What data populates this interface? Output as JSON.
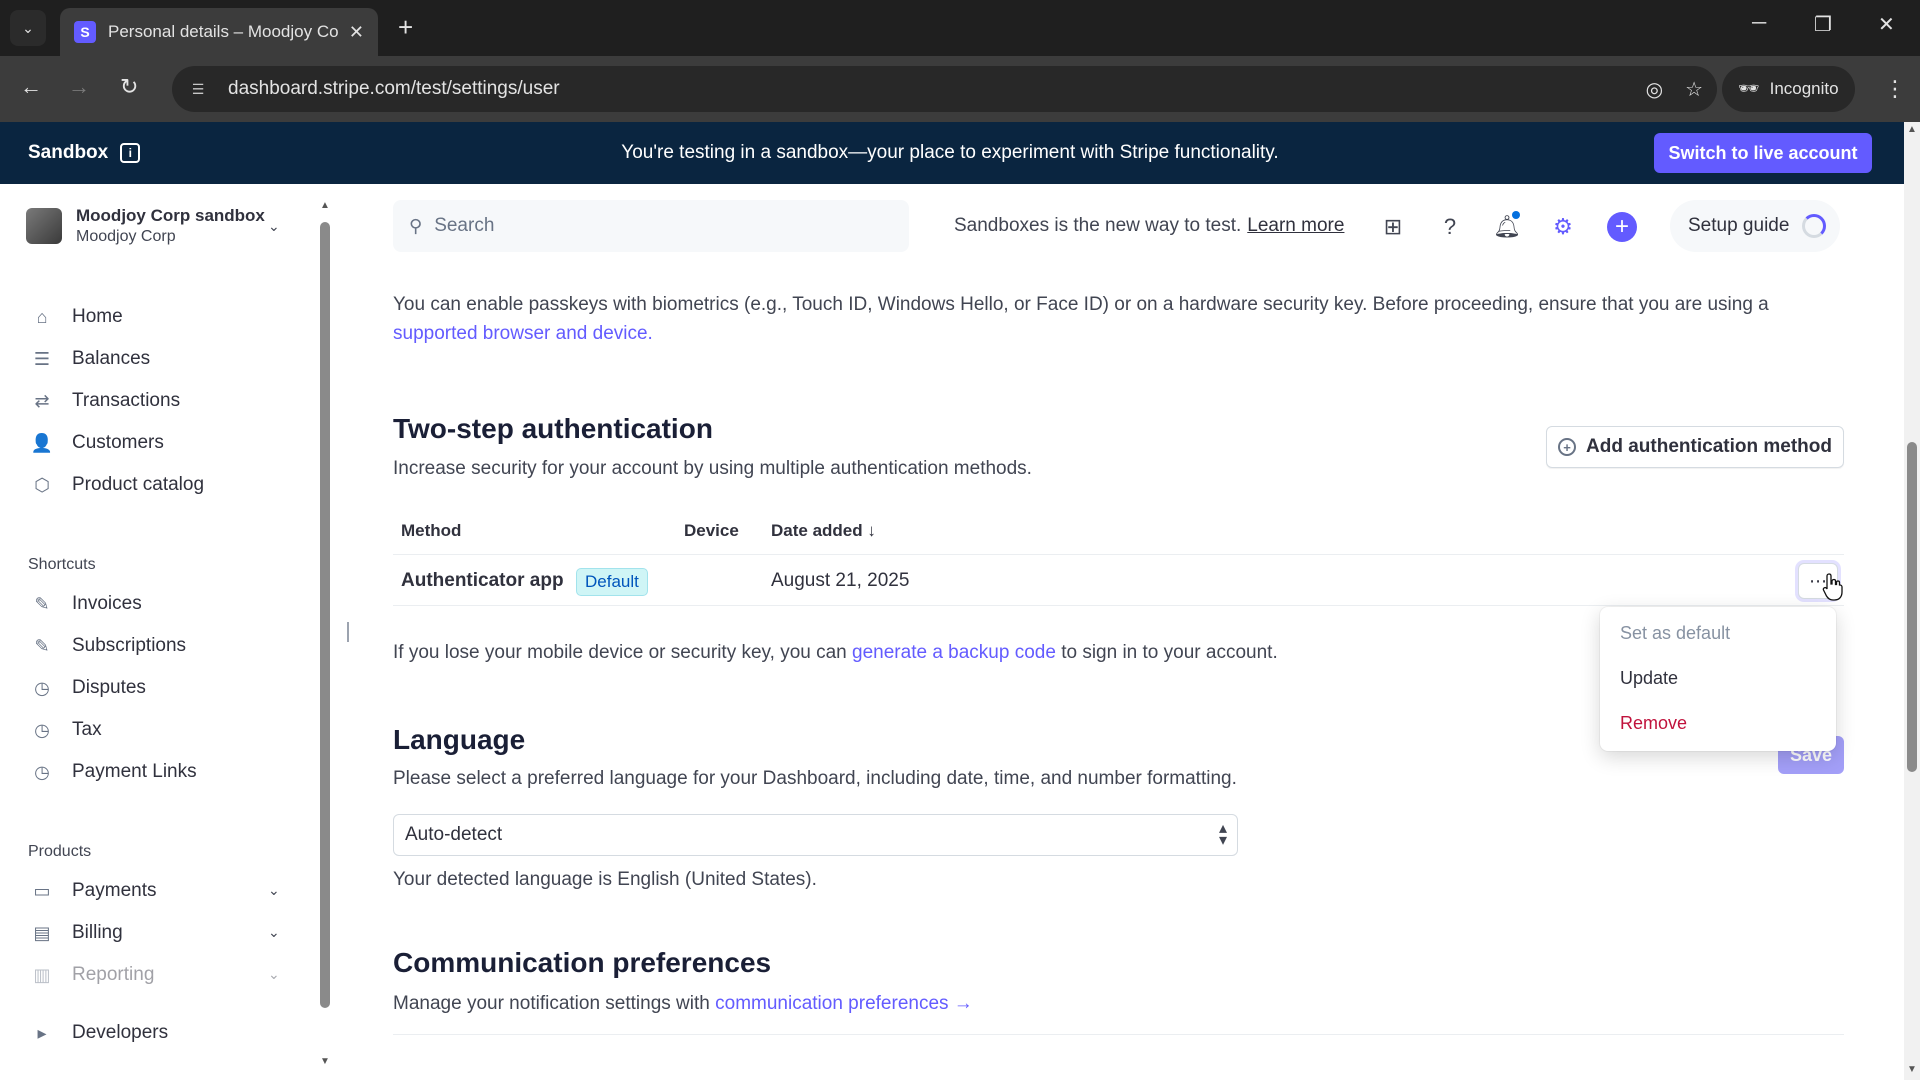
{
  "browser": {
    "tab_title": "Personal details – Moodjoy Corp",
    "favicon_letter": "S",
    "url": "dashboard.stripe.com/test/settings/user",
    "incognito_label": "Incognito"
  },
  "banner": {
    "label": "Sandbox",
    "message": "You're testing in a sandbox—your place to experiment with Stripe functionality.",
    "live_button": "Switch to live account"
  },
  "account": {
    "name": "Moodjoy Corp sandbox",
    "sub": "Moodjoy Corp"
  },
  "sidebar": {
    "items": [
      {
        "label": "Home",
        "icon": "home-icon"
      },
      {
        "label": "Balances",
        "icon": "balances-icon"
      },
      {
        "label": "Transactions",
        "icon": "transactions-icon"
      },
      {
        "label": "Customers",
        "icon": "customers-icon"
      },
      {
        "label": "Product catalog",
        "icon": "product-catalog-icon"
      }
    ],
    "shortcuts_heading": "Shortcuts",
    "shortcuts": [
      {
        "label": "Invoices",
        "icon": "pin-icon"
      },
      {
        "label": "Subscriptions",
        "icon": "pin-icon"
      },
      {
        "label": "Disputes",
        "icon": "clock-icon"
      },
      {
        "label": "Tax",
        "icon": "clock-icon"
      },
      {
        "label": "Payment Links",
        "icon": "clock-icon"
      }
    ],
    "products_heading": "Products",
    "products": [
      {
        "label": "Payments",
        "icon": "payments-icon"
      },
      {
        "label": "Billing",
        "icon": "billing-icon"
      },
      {
        "label": "Reporting",
        "icon": "reporting-icon"
      }
    ],
    "developers": "Developers"
  },
  "toolbar": {
    "search_placeholder": "Search",
    "sandbox_note": "Sandboxes is the new way to test.",
    "learn_more": "Learn more",
    "setup_guide": "Setup guide"
  },
  "passkeys": {
    "text": "You can enable passkeys with biometrics (e.g., Touch ID, Windows Hello, or Face ID) or on a hardware security key. Before proceeding, ensure that you are using a",
    "link": "supported browser and device."
  },
  "two_step": {
    "title": "Two-step authentication",
    "subtitle": "Increase security for your account by using multiple authentication methods.",
    "add_button": "Add authentication method",
    "columns": [
      "Method",
      "Device",
      "Date added ↓"
    ],
    "row": {
      "method": "Authenticator app",
      "badge": "Default",
      "device": "",
      "date": "August 21, 2025"
    },
    "backup_prefix": "If you lose your mobile device or security key, you can",
    "backup_link": "generate a backup code",
    "backup_suffix": "to sign in to your account."
  },
  "menu": {
    "items": [
      "Set as default",
      "Update",
      "Remove"
    ]
  },
  "language": {
    "title": "Language",
    "subtitle": "Please select a preferred language for your Dashboard, including date, time, and number formatting.",
    "value": "Auto-detect",
    "detected": "Your detected language is English (United States).",
    "save": "Save"
  },
  "communication": {
    "title": "Communication preferences",
    "prefix": "Manage your notification settings with",
    "link": "communication preferences →"
  },
  "colors": {
    "accent": "#635bff",
    "banner": "#0a2540",
    "danger": "#c0123c"
  }
}
